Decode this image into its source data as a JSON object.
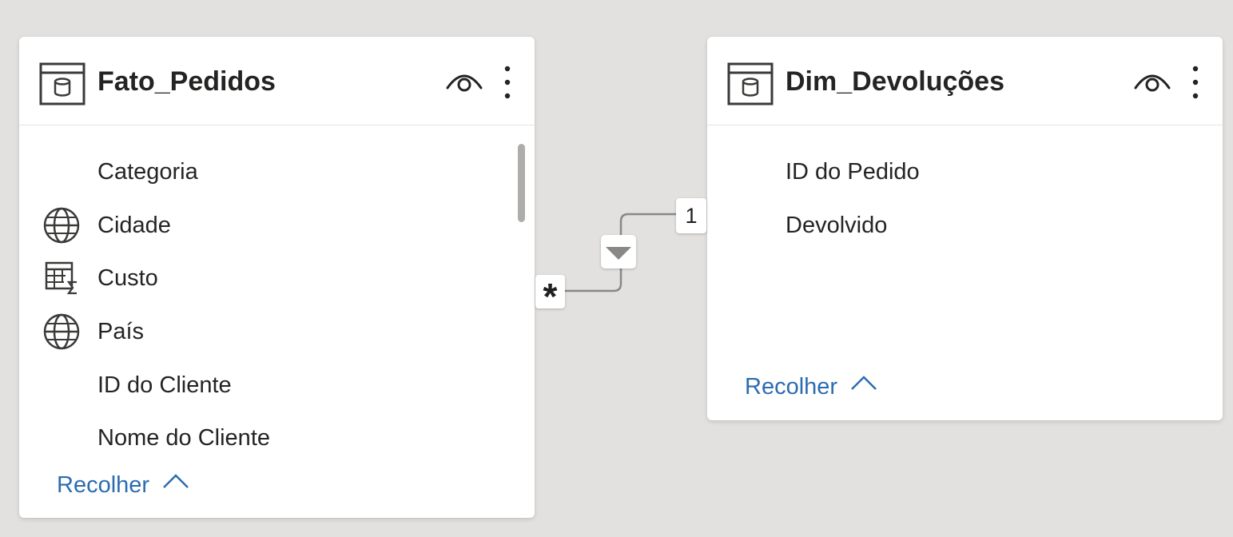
{
  "tables": [
    {
      "title": "Fato_Pedidos",
      "fields": [
        {
          "label": "Categoria",
          "icon": null
        },
        {
          "label": "Cidade",
          "icon": "globe-icon"
        },
        {
          "label": "Custo",
          "icon": "measure-table-icon"
        },
        {
          "label": "País",
          "icon": "globe-icon"
        },
        {
          "label": "ID do Cliente",
          "icon": null
        },
        {
          "label": "Nome do Cliente",
          "icon": null
        }
      ],
      "collapse_label": "Recolher"
    },
    {
      "title": "Dim_Devoluções",
      "fields": [
        {
          "label": "ID do Pedido",
          "icon": null
        },
        {
          "label": "Devolvido",
          "icon": null
        }
      ],
      "collapse_label": "Recolher"
    }
  ],
  "relationship": {
    "many_side": "*",
    "one_side": "1",
    "cross_filter_icon": "triangle-down-icon"
  },
  "colors": {
    "canvas": "#e3e1df",
    "card": "#ffffff",
    "link": "#2b6cb0",
    "text": "#252423",
    "connector": "#8a8886"
  }
}
